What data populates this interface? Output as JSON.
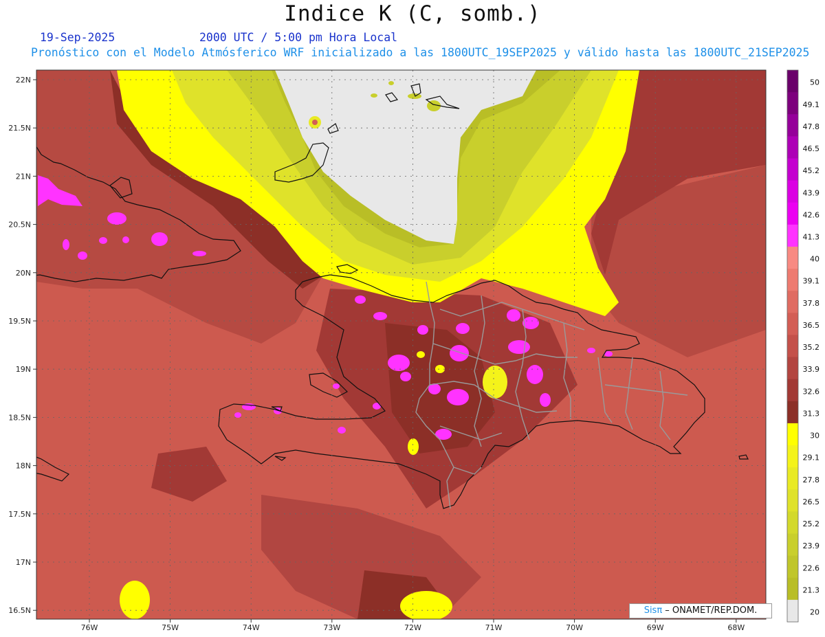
{
  "header": {
    "title": "Indice K (C, somb.)",
    "date": "19-Sep-2025",
    "time": "2000 UTC / 5:00 pm Hora Local",
    "forecast": "Pronóstico con el Modelo Atmósferico WRF inicializado a las 1800UTC_19SEP2025 y válido hasta las  1800UTC_21SEP2025"
  },
  "axes": {
    "lat_labels": [
      "22N",
      "21.5N",
      "21N",
      "20.5N",
      "20N",
      "19.5N",
      "19N",
      "18.5N",
      "18N",
      "17.5N",
      "17N",
      "16.5N"
    ],
    "lon_labels": [
      "76W",
      "75W",
      "74W",
      "73W",
      "72W",
      "71W",
      "70W",
      "69W",
      "68W"
    ]
  },
  "colorbar": {
    "labels": [
      "50",
      "49.1",
      "47.8",
      "46.5",
      "45.2",
      "43.9",
      "42.6",
      "41.3",
      "40",
      "39.1",
      "37.8",
      "36.5",
      "35.2",
      "33.9",
      "32.6",
      "31.3",
      "30",
      "29.1",
      "27.8",
      "26.5",
      "25.2",
      "23.9",
      "22.6",
      "21.3",
      "20"
    ],
    "colors": [
      "#6a006a",
      "#7d007d",
      "#95009a",
      "#ad00b6",
      "#c400cf",
      "#db00e3",
      "#ec00f2",
      "#ff33ff",
      "#f88a82",
      "#ee7b70",
      "#e06c62",
      "#d35e55",
      "#c4514a",
      "#b34540",
      "#a23935",
      "#8c2f27",
      "#ffff00",
      "#f4f31a",
      "#e9ea24",
      "#dfe22a",
      "#d3d92c",
      "#c9cf2c",
      "#c0c62a",
      "#b9be26",
      "#e8e8e8"
    ]
  },
  "credit": {
    "brand": "Sisπ",
    "rest": " – ONAMET/REP.DOM."
  }
}
